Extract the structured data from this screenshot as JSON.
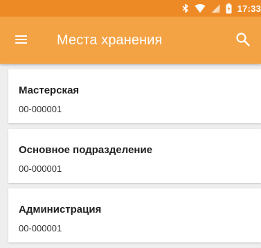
{
  "colors": {
    "status_bar": "#ee8a25",
    "app_bar": "#f3a244",
    "background": "#eeeeee",
    "card": "#ffffff",
    "title_text": "#212121",
    "code_text": "#333333"
  },
  "status_bar": {
    "icons": [
      "bluetooth-icon",
      "wifi-icon",
      "no-sim-icon",
      "battery-icon"
    ],
    "time": "17:33"
  },
  "app_bar": {
    "menu_icon": "hamburger-menu-icon",
    "title": "Места хранения",
    "search_icon": "search-icon"
  },
  "storage_locations": [
    {
      "name": "Мастерская",
      "code": "00-000001"
    },
    {
      "name": "Основное подразделение",
      "code": "00-000001"
    },
    {
      "name": "Администрация",
      "code": "00-000001"
    }
  ]
}
